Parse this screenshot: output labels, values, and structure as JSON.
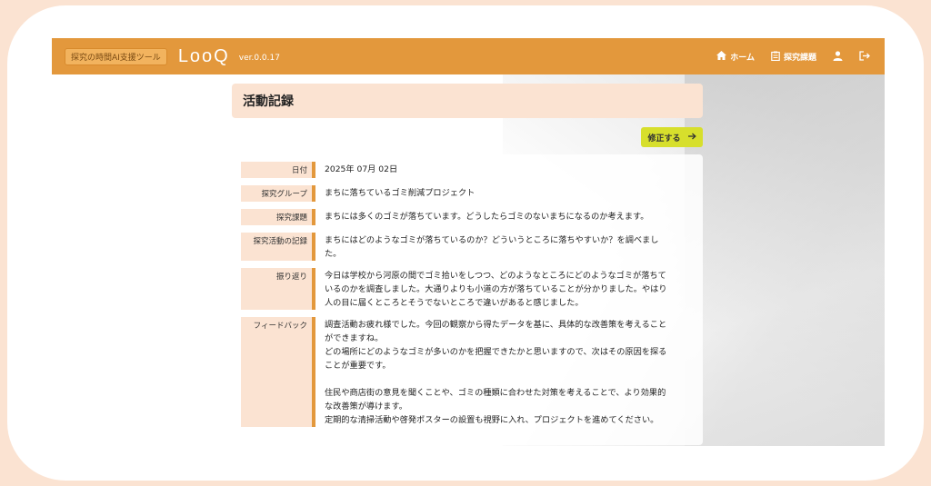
{
  "header": {
    "tag": "探究の時間AI支援ツール",
    "logo": "LooQ",
    "version": "ver.0.0.17",
    "nav": {
      "home": "ホーム",
      "topic": "探究課題"
    }
  },
  "page": {
    "title": "活動記録",
    "edit_label": "修正する"
  },
  "record": [
    {
      "label": "日付",
      "value": "2025年 07月 02日"
    },
    {
      "label": "探究グループ",
      "value": "まちに落ちているゴミ削減プロジェクト"
    },
    {
      "label": "探究課題",
      "value": "まちには多くのゴミが落ちています。どうしたらゴミのないまちになるのか考えます。"
    },
    {
      "label": "探究活動の記録",
      "value": "まちにはどのようなゴミが落ちているのか？どういうところに落ちやすいか？を調べまし\nた。"
    },
    {
      "label": "振り返り",
      "value": "今日は学校から河原の間でゴミ拾いをしつつ、どのようなところにどのようなゴミが落ちて\nいるのかを調査しました。大通りよりも小道の方が落ちていることが分かりました。やはり\n人の目に届くところとそうでないところで違いがあると感じました。"
    },
    {
      "label": "フィードバック",
      "value": "調査活動お疲れ様でした。今回の観察から得たデータを基に、具体的な改善策を考えること\nができますね。\nどの場所にどのようなゴミが多いのかを把握できたかと思いますので、次はその原因を探る\nことが重要です。\n\n住民や商店街の意見を聞くことや、ゴミの種類に合わせた対策を考えることで、より効果的\nな改善策が導けます。\n定期的な清掃活動や啓発ポスターの設置も視野に入れ、プロジェクトを進めてください。"
    }
  ],
  "colors": {
    "header": "#e3983c",
    "accent_light": "#fbe3d2",
    "button": "#d7df2c"
  }
}
